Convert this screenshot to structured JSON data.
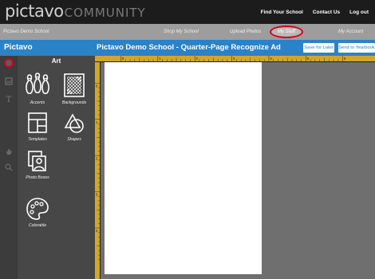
{
  "logo": {
    "brand": "pictavo",
    "community": "COMMUNITY"
  },
  "top_nav": {
    "find_school": "Find Your School",
    "contact": "Contact Us",
    "logout": "Log out"
  },
  "sub_nav": {
    "school": "Pictavo Demo School",
    "shop": "Shop My School",
    "upload": "Upload Photos",
    "my_stuff": "My Stuff",
    "account": "My Account"
  },
  "header": {
    "app_title": "Pictavo",
    "doc_title": "Pictavo Demo School - Quarter-Page  Recognize Ad",
    "save_later": "Save for Later",
    "send_yearbook": "Send to Yearbook"
  },
  "panel": {
    "title": "Art",
    "items": [
      {
        "label": "Accents"
      },
      {
        "label": "Backgrounds"
      },
      {
        "label": "Templates"
      },
      {
        "label": "Shapes"
      },
      {
        "label": "Photo Boxes"
      },
      {
        "label": "Colorable"
      }
    ]
  },
  "ruler": {
    "top_ticks": [
      "0",
      "1",
      "2",
      "3",
      "4",
      "5",
      "6"
    ],
    "left_ticks": [
      "0",
      "1",
      "2",
      "3",
      "4",
      "5"
    ]
  },
  "colors": {
    "accent_blue": "#2b82c6",
    "highlight_red": "#d4001a",
    "ruler_gold": "#d0a72a"
  }
}
